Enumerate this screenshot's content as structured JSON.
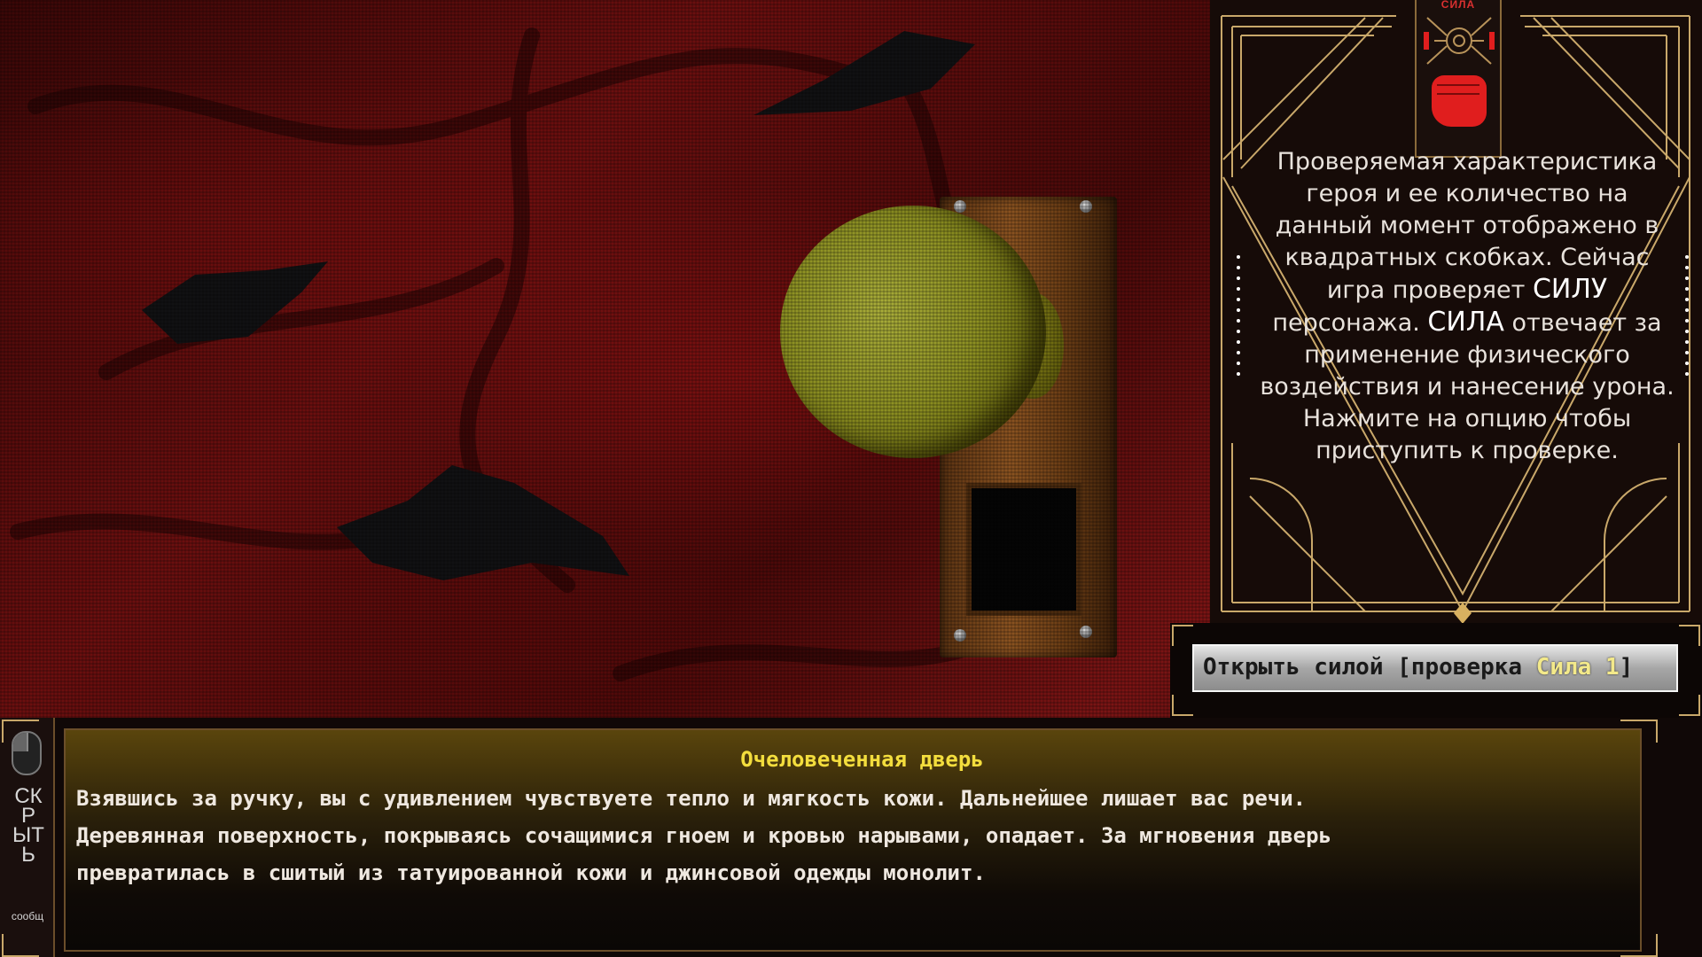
{
  "scene": {
    "object": "doorknob"
  },
  "tutorial": {
    "card_label": "СИЛА",
    "card_icon": "fist-icon",
    "text_before_1": "Проверяемая характеристика героя и ее количество на данный момент отображено в квадратных скобках. Сейчас игра проверяет ",
    "stat_1": "СИЛУ",
    "text_mid": " персонажа. ",
    "stat_2": "СИЛА",
    "text_after": " отвечает за применение физического воздействия и нанесение урона. Нажмите на опцию чтобы приступить к проверке."
  },
  "choice": {
    "label_main": "Открыть силой [проверка ",
    "label_stat": "Сила 1",
    "label_end": "]"
  },
  "dialogue": {
    "speaker": "Очеловеченная дверь",
    "text": "Взявшись за ручку, вы с удивлением чувствуете тепло и мягкость кожи. Дальнейшее лишает вас речи.\nДеревянная поверхность, покрываясь сочащимися гноем и кровью нарывами, опадает. За мгновения дверь\nпревратилась в сшитый из татуированной кожи и джинсовой одежды монолит."
  },
  "hide_tab": {
    "label": "СКРЫТЬ",
    "sub": "сообщ",
    "icon": "mouse-icon"
  },
  "colors": {
    "speaker": "#f3dd3d",
    "choice_highlight": "#f3e98a",
    "card_accent": "#e01e1e",
    "gold_frame": "#c9a86a"
  }
}
